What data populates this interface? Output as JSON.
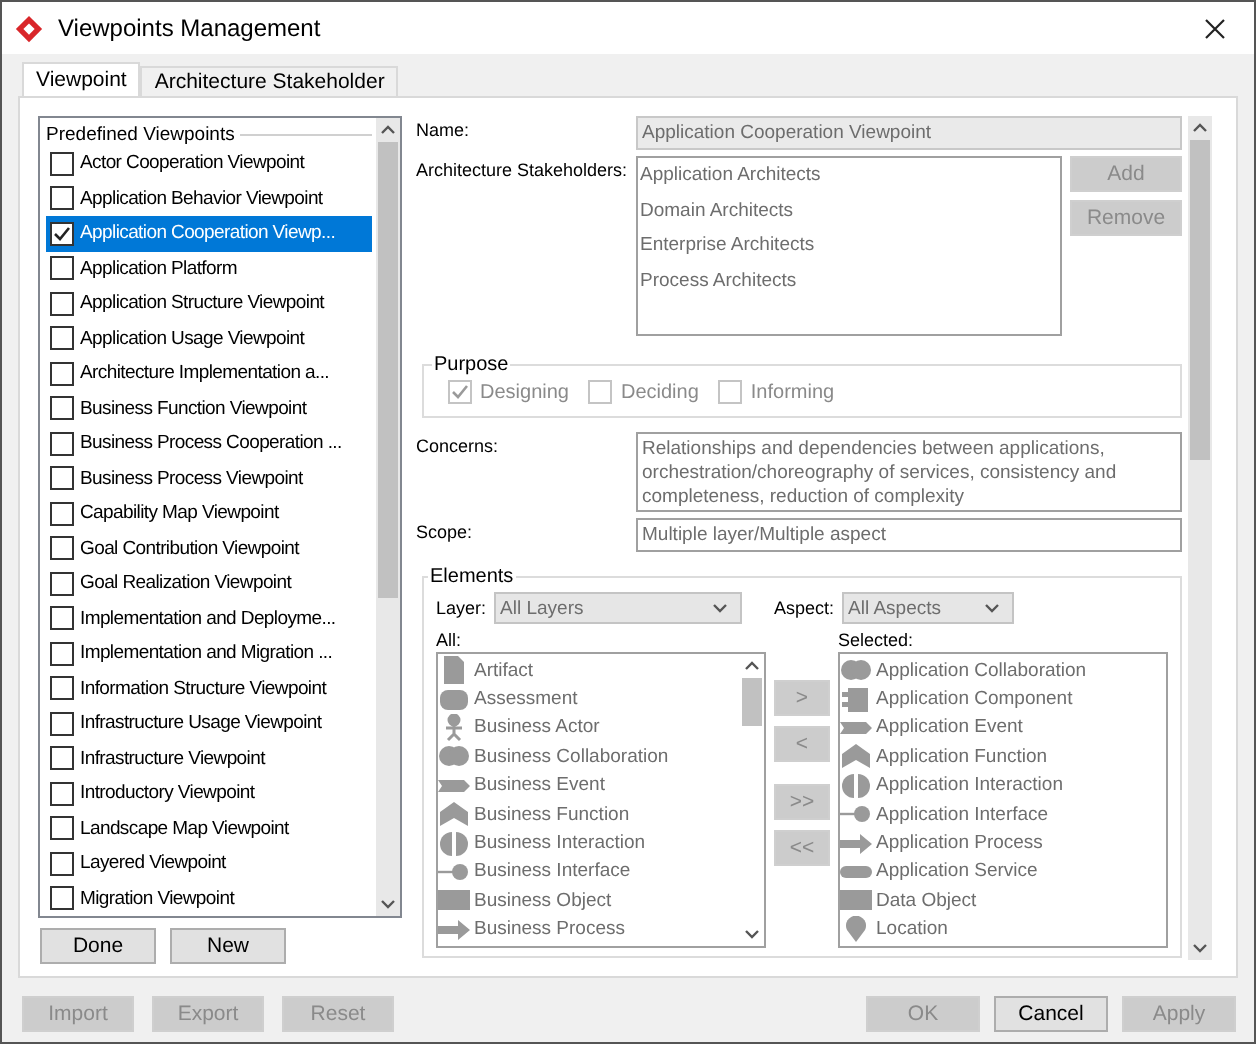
{
  "window": {
    "title": "Viewpoints Management"
  },
  "tabs": [
    {
      "label": "Viewpoint",
      "selected": true
    },
    {
      "label": "Architecture Stakeholder",
      "selected": false
    }
  ],
  "viewpoints": {
    "legend": "Predefined Viewpoints",
    "items": [
      {
        "label": "Actor Cooperation Viewpoint",
        "checked": false,
        "selected": false
      },
      {
        "label": "Application Behavior Viewpoint",
        "checked": false,
        "selected": false
      },
      {
        "label": "Application Cooperation Viewp...",
        "checked": true,
        "selected": true
      },
      {
        "label": "Application Platform",
        "checked": false,
        "selected": false
      },
      {
        "label": "Application Structure Viewpoint",
        "checked": false,
        "selected": false
      },
      {
        "label": "Application Usage Viewpoint",
        "checked": false,
        "selected": false
      },
      {
        "label": "Architecture Implementation a...",
        "checked": false,
        "selected": false
      },
      {
        "label": "Business Function Viewpoint",
        "checked": false,
        "selected": false
      },
      {
        "label": "Business Process Cooperation ...",
        "checked": false,
        "selected": false
      },
      {
        "label": "Business Process Viewpoint",
        "checked": false,
        "selected": false
      },
      {
        "label": "Capability Map Viewpoint",
        "checked": false,
        "selected": false
      },
      {
        "label": "Goal Contribution Viewpoint",
        "checked": false,
        "selected": false
      },
      {
        "label": "Goal Realization Viewpoint",
        "checked": false,
        "selected": false
      },
      {
        "label": "Implementation and Deployme...",
        "checked": false,
        "selected": false
      },
      {
        "label": "Implementation and Migration ...",
        "checked": false,
        "selected": false
      },
      {
        "label": "Information Structure Viewpoint",
        "checked": false,
        "selected": false
      },
      {
        "label": "Infrastructure Usage Viewpoint",
        "checked": false,
        "selected": false
      },
      {
        "label": "Infrastructure Viewpoint",
        "checked": false,
        "selected": false
      },
      {
        "label": "Introductory Viewpoint",
        "checked": false,
        "selected": false
      },
      {
        "label": "Landscape Map Viewpoint",
        "checked": false,
        "selected": false
      },
      {
        "label": "Layered Viewpoint",
        "checked": false,
        "selected": false
      },
      {
        "label": "Migration Viewpoint",
        "checked": false,
        "selected": false
      }
    ]
  },
  "list_buttons": [
    {
      "label": "Done",
      "disabled": false
    },
    {
      "label": "New",
      "disabled": false
    }
  ],
  "name": {
    "label": "Name:",
    "value": "Application Cooperation Viewpoint"
  },
  "stakeholders": {
    "label": "Architecture Stakeholders:",
    "items": [
      "Application Architects",
      "Domain Architects",
      "Enterprise Architects",
      "Process Architects"
    ],
    "buttons": [
      {
        "label": "Add",
        "disabled": true
      },
      {
        "label": "Remove",
        "disabled": true
      }
    ]
  },
  "purpose": {
    "legend": "Purpose",
    "options": [
      {
        "label": "Designing",
        "checked": true,
        "disabled": true
      },
      {
        "label": "Deciding",
        "checked": false,
        "disabled": true
      },
      {
        "label": "Informing",
        "checked": false,
        "disabled": true
      }
    ]
  },
  "concerns": {
    "label": "Concerns:",
    "value": "Relationships and dependencies between applications, orchestration/choreography of services, consistency and completeness, reduction of complexity"
  },
  "scope": {
    "label": "Scope:",
    "value": "Multiple layer/Multiple aspect"
  },
  "elements": {
    "legend": "Elements",
    "layer": {
      "label": "Layer:",
      "value": "All Layers"
    },
    "aspect": {
      "label": "Aspect:",
      "value": "All Aspects"
    },
    "all": {
      "label": "All:",
      "items": [
        {
          "label": "Artifact",
          "kind": "artifact"
        },
        {
          "label": "Assessment",
          "kind": "assessment"
        },
        {
          "label": "Business Actor",
          "kind": "actor"
        },
        {
          "label": "Business Collaboration",
          "kind": "collaboration"
        },
        {
          "label": "Business Event",
          "kind": "event"
        },
        {
          "label": "Business Function",
          "kind": "function"
        },
        {
          "label": "Business Interaction",
          "kind": "interaction"
        },
        {
          "label": "Business Interface",
          "kind": "interface"
        },
        {
          "label": "Business Object",
          "kind": "object"
        },
        {
          "label": "Business Process",
          "kind": "process"
        }
      ]
    },
    "transfer_buttons": [
      {
        "label": ">",
        "disabled": true
      },
      {
        "label": "<",
        "disabled": true
      },
      {
        "label": ">>",
        "disabled": true
      },
      {
        "label": "<<",
        "disabled": true
      }
    ],
    "selected": {
      "label": "Selected:",
      "items": [
        {
          "label": "Application Collaboration",
          "kind": "collaboration"
        },
        {
          "label": "Application Component",
          "kind": "component"
        },
        {
          "label": "Application Event",
          "kind": "event"
        },
        {
          "label": "Application Function",
          "kind": "function"
        },
        {
          "label": "Application Interaction",
          "kind": "interaction"
        },
        {
          "label": "Application Interface",
          "kind": "interface"
        },
        {
          "label": "Application Process",
          "kind": "process"
        },
        {
          "label": "Application Service",
          "kind": "service"
        },
        {
          "label": "Data Object",
          "kind": "object"
        },
        {
          "label": "Location",
          "kind": "location"
        }
      ]
    }
  },
  "footer_buttons": [
    {
      "label": "Import",
      "disabled": true
    },
    {
      "label": "Export",
      "disabled": true
    },
    {
      "label": "Reset",
      "disabled": true
    },
    {
      "label": "OK",
      "disabled": true
    },
    {
      "label": "Cancel",
      "disabled": false
    },
    {
      "label": "Apply",
      "disabled": true
    }
  ]
}
